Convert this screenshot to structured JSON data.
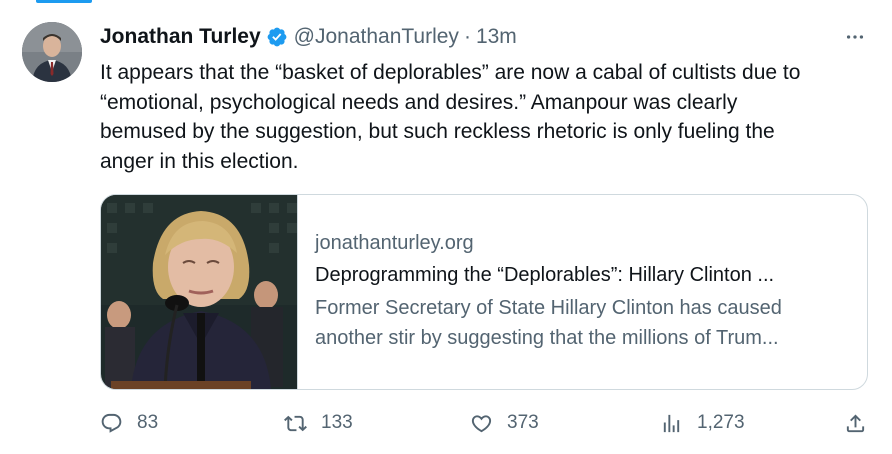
{
  "tweet": {
    "author_name": "Jonathan Turley",
    "handle": "@JonathanTurley",
    "separator": "·",
    "time": "13m",
    "text": "It appears that the “basket of deplorables” are now a cabal of cultists due to\n“emotional, psychological needs and desires.” Amanpour was clearly\nbemused by the suggestion, but such reckless rhetoric is only fueling the\nanger in this election."
  },
  "card": {
    "domain": "jonathanturley.org",
    "title": "Deprogramming the “Deplorables”: Hillary Clinton ...",
    "description": "Former Secretary of State Hillary Clinton has caused another stir by suggesting that the millions of Trum..."
  },
  "actions": {
    "replies": "83",
    "reposts": "133",
    "likes": "373",
    "views": "1,273"
  },
  "colors": {
    "accent": "#1d9bf0",
    "text": "#0f1419",
    "secondary": "#536471",
    "border": "#cfd9de"
  },
  "icons": [
    "verified-badge-icon",
    "more-icon",
    "reply-icon",
    "repost-icon",
    "like-icon",
    "views-icon",
    "share-icon"
  ]
}
